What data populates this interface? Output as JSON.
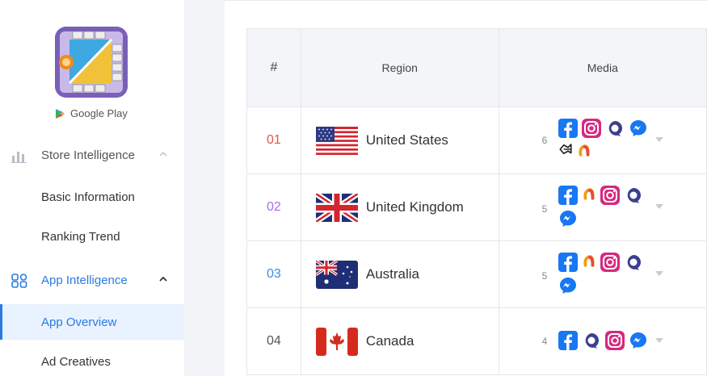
{
  "sidebar": {
    "app_icon": "game-app-icon",
    "store_label": "Google Play",
    "groups": [
      {
        "label": "Store Intelligence",
        "icon": "bar-chart-icon",
        "expanded": false
      },
      {
        "label": "App Intelligence",
        "icon": "grid-apps-icon",
        "expanded": true
      }
    ],
    "items": [
      {
        "label": "Basic Information"
      },
      {
        "label": "Ranking Trend"
      },
      {
        "label": "App Overview",
        "active": true
      },
      {
        "label": "Ad Creatives"
      }
    ],
    "accent_color": "#2a7ae2"
  },
  "table": {
    "headers": {
      "num": "#",
      "region": "Region",
      "media": "Media"
    },
    "rows": [
      {
        "num": "01",
        "num_color": "#e8553f",
        "region": "United States",
        "flag": "us-flag-icon",
        "media_count": "6",
        "media": [
          "facebook-icon",
          "instagram-icon",
          "audience-network-icon",
          "messenger-icon",
          "unity-icon",
          "applovin-icon"
        ]
      },
      {
        "num": "02",
        "num_color": "#a66fe6",
        "region": "United Kingdom",
        "flag": "uk-flag-icon",
        "media_count": "5",
        "media": [
          "facebook-icon",
          "applovin-icon",
          "instagram-icon",
          "audience-network-icon",
          "messenger-icon"
        ]
      },
      {
        "num": "03",
        "num_color": "#3a8ee6",
        "region": "Australia",
        "flag": "au-flag-icon",
        "media_count": "5",
        "media": [
          "facebook-icon",
          "applovin-icon",
          "instagram-icon",
          "audience-network-icon",
          "messenger-icon"
        ]
      },
      {
        "num": "04",
        "num_color": "#555555",
        "region": "Canada",
        "flag": "ca-flag-icon",
        "media_count": "4",
        "media": [
          "facebook-icon",
          "audience-network-icon",
          "instagram-icon",
          "messenger-icon"
        ]
      }
    ]
  }
}
